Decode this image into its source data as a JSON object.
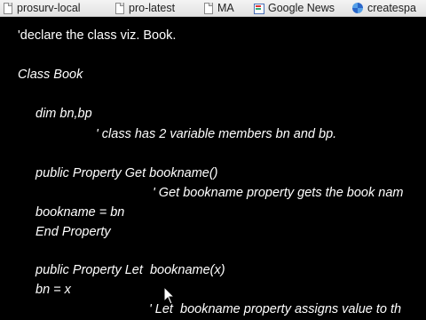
{
  "bookmarks": [
    {
      "label": "prosurv-local",
      "icon": "page-icon"
    },
    {
      "label": "pro-latest",
      "icon": "page-icon"
    },
    {
      "label": "MA",
      "icon": "page-icon"
    },
    {
      "label": "Google News",
      "icon": "google-news-icon"
    },
    {
      "label": "createspa",
      "icon": "createspace-icon"
    }
  ],
  "code": {
    "comment_declare": "'declare the class viz. Book.",
    "class_book": "Class Book",
    "dim": "dim bn,bp",
    "comment_members": "' class has 2 variable members bn and bp.",
    "get_sig": "public Property Get bookname()",
    "comment_get": "' Get bookname property gets the book nam",
    "assign_get": "bookname = bn",
    "end_property": "End Property",
    "let_sig": "public Property Let  bookname(x)",
    "assign_let": "bn = x",
    "comment_let": "' Let  bookname property assigns value to th"
  },
  "colors": {
    "background": "#000000",
    "text": "#ffffff",
    "bookmarks_bar": "#ececec"
  }
}
